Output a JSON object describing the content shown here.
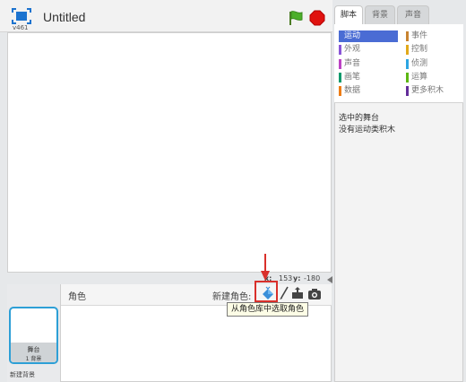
{
  "stage": {
    "version": "v461",
    "project_title": "Untitled",
    "coords": {
      "x_label": "x:",
      "x_value": "153",
      "y_label": "y:",
      "y_value": "-180"
    }
  },
  "sprites": {
    "header_label": "角色",
    "new_sprite_label": "新建角色:",
    "tooltip": "从角色库中选取角色",
    "stage_thumb_name": "舞台",
    "stage_thumb_count": "1 背景",
    "new_backdrop_label": "新建背景"
  },
  "tabs": [
    {
      "label": "脚本"
    },
    {
      "label": "背景"
    },
    {
      "label": "声音"
    }
  ],
  "categories": [
    {
      "label": "运动",
      "color": "#4a6cd4"
    },
    {
      "label": "事件",
      "color": "#c88330"
    },
    {
      "label": "外观",
      "color": "#8a55d7"
    },
    {
      "label": "控制",
      "color": "#e1a91a"
    },
    {
      "label": "声音",
      "color": "#bb42c3"
    },
    {
      "label": "侦测",
      "color": "#2ca5e2"
    },
    {
      "label": "画笔",
      "color": "#0e9a6c"
    },
    {
      "label": "运算",
      "color": "#5cb712"
    },
    {
      "label": "数据",
      "color": "#ee7d16"
    },
    {
      "label": "更多积木",
      "color": "#632d99"
    }
  ],
  "info": {
    "selected_sprite": "选中的舞台",
    "no_blocks": "没有运动类积木"
  },
  "colors": {
    "accent": "#4a6cd4",
    "highlight_red": "#d9302b",
    "thumb_border": "#2d9fd6"
  }
}
